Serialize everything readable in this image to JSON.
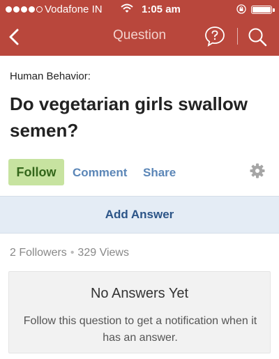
{
  "status_bar": {
    "carrier": "Vodafone IN",
    "time": "1:05 am",
    "signal_bars_filled": 4,
    "signal_bars_total": 5,
    "battery_level": 1.0
  },
  "nav": {
    "title": "Question",
    "back_icon": "chevron-left-icon",
    "help_icon": "question-bubble-icon",
    "search_icon": "search-icon"
  },
  "question": {
    "topic": "Human Behavior:",
    "title": "Do vegetarian girls swallow semen?"
  },
  "actions": {
    "follow_label": "Follow",
    "comment_label": "Comment",
    "share_label": "Share",
    "settings_icon": "gear-icon"
  },
  "add_answer_label": "Add Answer",
  "stats": {
    "followers": "2 Followers",
    "separator": "•",
    "views": "329 Views"
  },
  "empty_state": {
    "title": "No Answers Yet",
    "body": "Follow this question to get a notification when it has an answer."
  },
  "colors": {
    "header": "#b9473c",
    "follow_bg": "#c7e3a0",
    "link": "#5b86b7",
    "add_answer_bg": "#e4ecf5"
  }
}
